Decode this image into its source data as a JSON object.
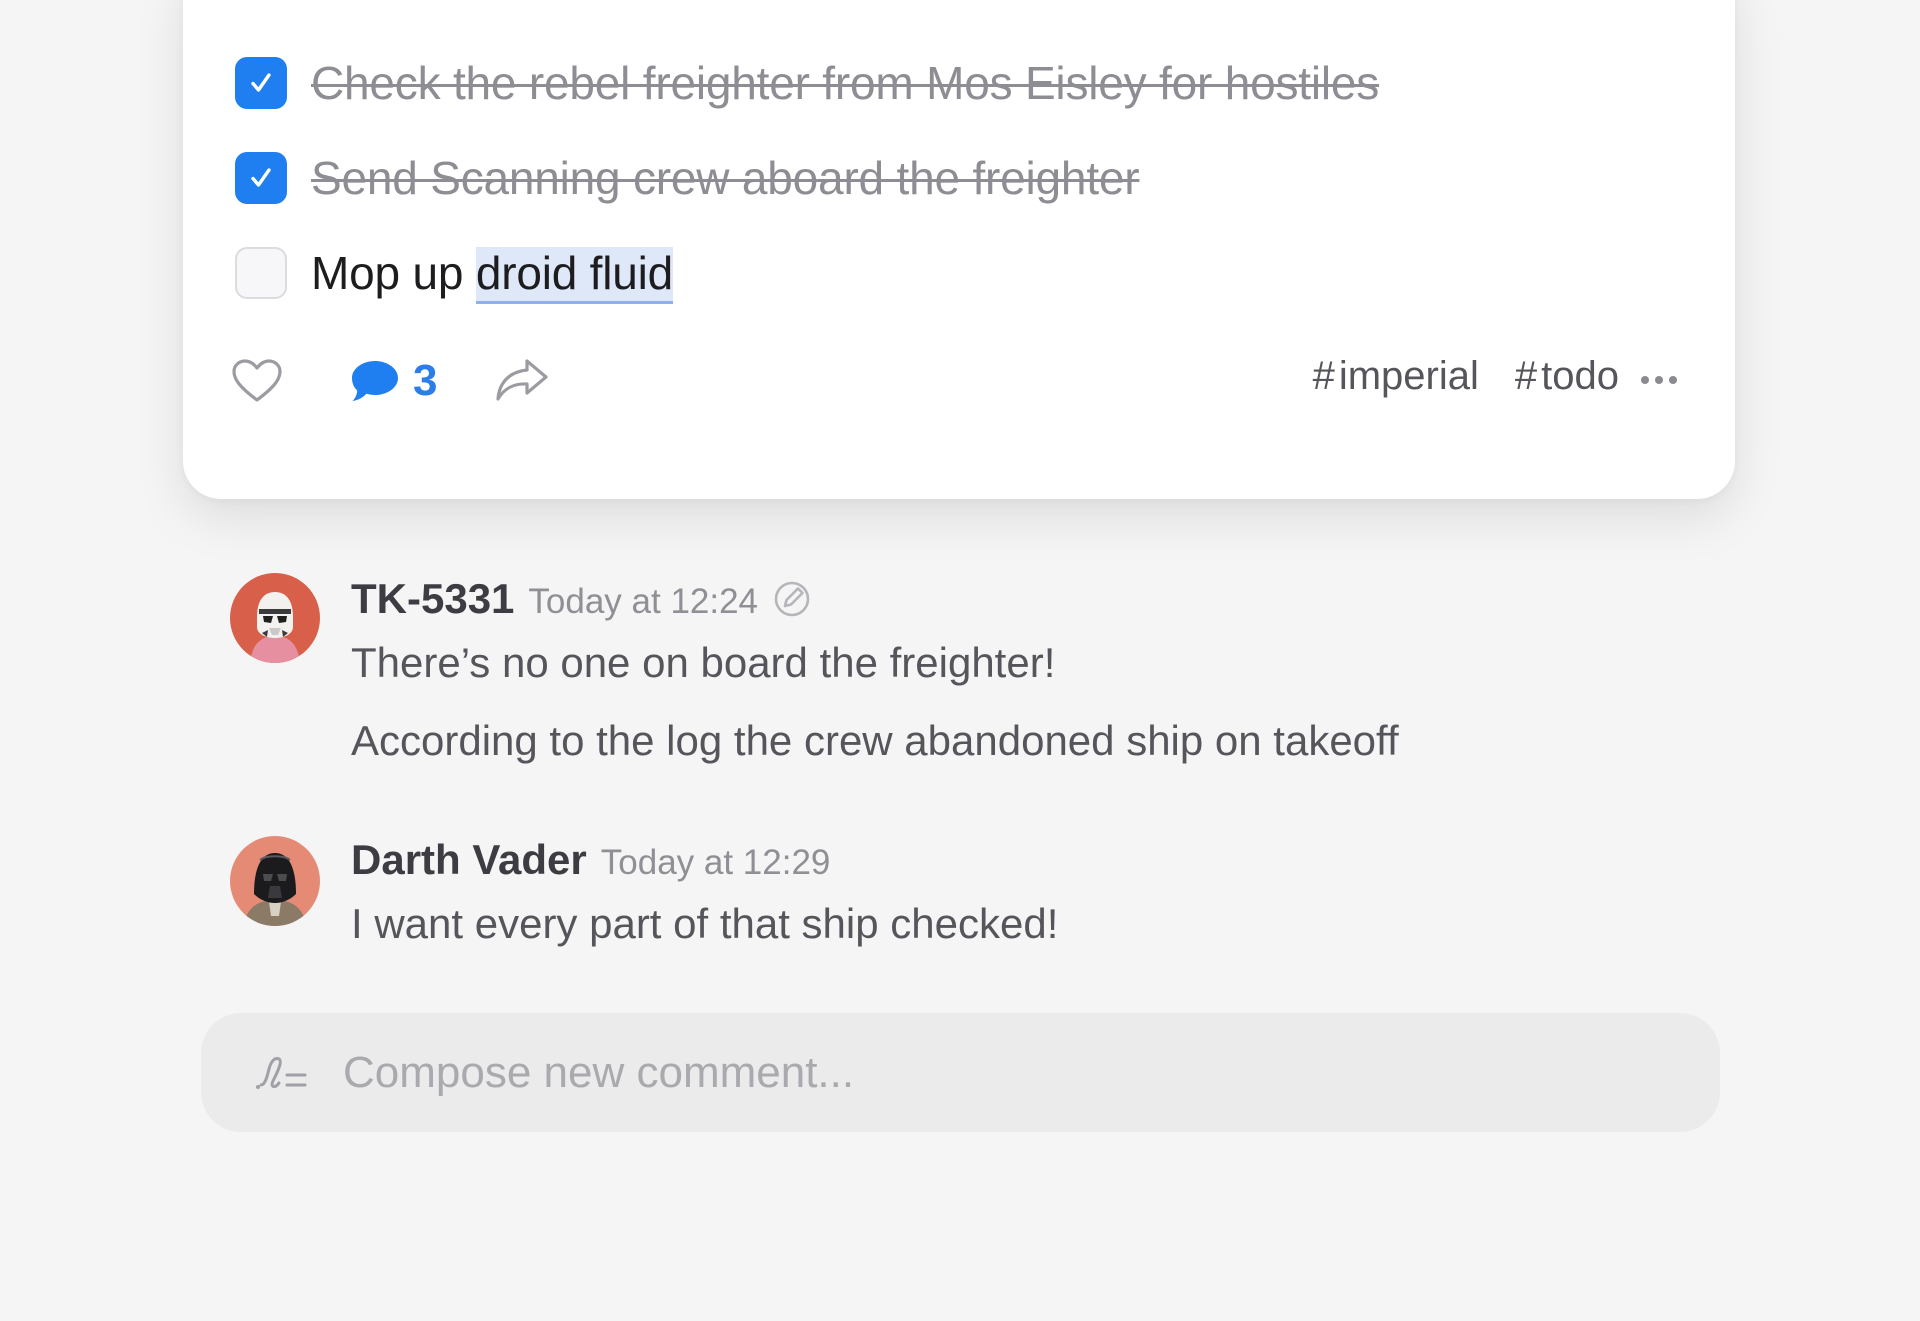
{
  "post": {
    "todos": [
      {
        "text": "Check the rebel freighter from Mos Eisley for hostiles",
        "done": true
      },
      {
        "text": "Send Scanning crew aboard the freighter",
        "done": true
      },
      {
        "text_prefix": "Mop up ",
        "text_highlight": "droid fluid",
        "done": false
      }
    ],
    "actions": {
      "like_icon": "heart-outline-icon",
      "comment_icon": "speech-bubble-icon",
      "comment_count": "3",
      "share_icon": "share-arrow-icon",
      "more_icon": "ellipsis-icon"
    },
    "tags": [
      {
        "hash": "#",
        "label": "imperial"
      },
      {
        "hash": "#",
        "label": "todo"
      }
    ]
  },
  "comments": [
    {
      "author": "TK-5331",
      "time": "Today at 12:24",
      "edited_icon": "pencil-circle-icon",
      "messages": [
        "There’s no one on board the freighter!",
        "According to the log the crew abandoned ship on takeoff"
      ]
    },
    {
      "author": "Darth Vader",
      "time": "Today at 12:29",
      "messages": [
        "I want every part of that ship checked!"
      ]
    }
  ],
  "composer": {
    "placeholder": "Compose new comment...",
    "icon": "signature-icon"
  },
  "colors": {
    "accent": "#1f7ff0",
    "comment_count": "#2b7de9",
    "background": "#f5f5f6",
    "card": "#ffffff"
  }
}
